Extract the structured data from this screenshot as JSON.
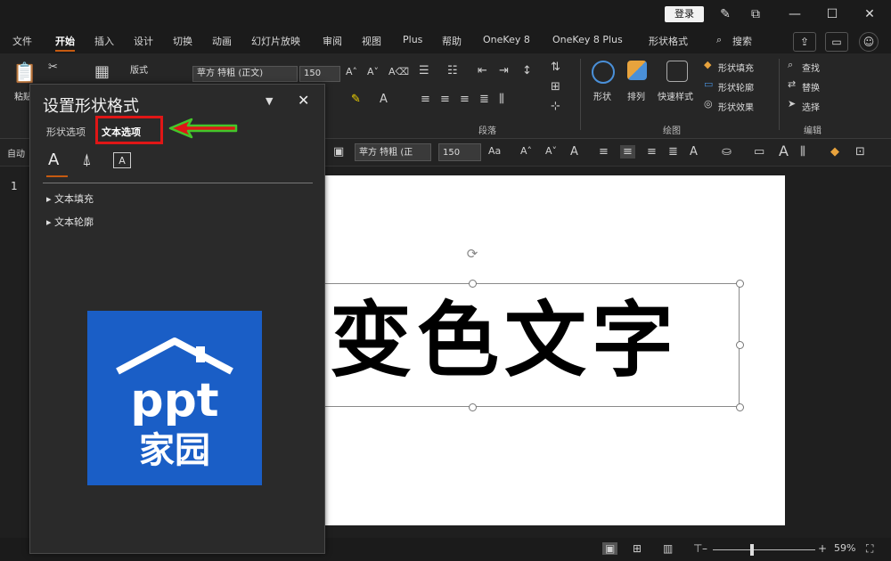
{
  "titlebar": {
    "login_label": "登录",
    "icons": [
      "pen-icon",
      "share-icon",
      "minimize-icon",
      "maximize-icon",
      "close-icon"
    ]
  },
  "ribbon_tabs": [
    {
      "label": "文件",
      "active": false
    },
    {
      "label": "开始",
      "active": true
    },
    {
      "label": "插入",
      "active": false
    },
    {
      "label": "设计",
      "active": false
    },
    {
      "label": "切换",
      "active": false
    },
    {
      "label": "动画",
      "active": false
    },
    {
      "label": "幻灯片放映",
      "active": false
    },
    {
      "label": "审阅",
      "active": false
    },
    {
      "label": "视图",
      "active": false
    },
    {
      "label": "Plus",
      "active": false
    },
    {
      "label": "帮助",
      "active": false
    },
    {
      "label": "OneKey 8",
      "active": false
    },
    {
      "label": "OneKey 8 Plus",
      "active": false
    },
    {
      "label": "形状格式",
      "active": false
    }
  ],
  "search_label": "搜索",
  "ribbon": {
    "paste_label": "粘贴",
    "layout_label": "版式",
    "font_name": "苹方 特粗 (正文)",
    "font_size": "150",
    "paragraph_group": "段落",
    "drawing_group": "绘图",
    "editing_group": "编辑",
    "shape_label": "形状",
    "arrange_label": "排列",
    "quick_style_label": "快速样式",
    "shape_fill_label": "形状填充",
    "shape_outline_label": "形状轮廓",
    "shape_effect_label": "形状效果",
    "find_label": "查找",
    "replace_label": "替换",
    "select_label": "选择"
  },
  "format_bar": {
    "auto_label": "自动",
    "font_name": "苹方 特粗 (正",
    "font_size": "150"
  },
  "thumbnail_number": "1",
  "slide": {
    "text": "变色文字"
  },
  "pane": {
    "title": "设置形状格式",
    "tab_shape": "形状选项",
    "tab_text": "文本选项",
    "icon_A_label": "A",
    "icon_C_label": "A",
    "sections": [
      "文本填充",
      "文本轮廓"
    ],
    "logo_line1": "ppt",
    "logo_line2": "家园"
  },
  "statusbar": {
    "zoom": "59%"
  },
  "colors": {
    "annotation_box": "#e01616",
    "arrow_fill": "#e01616",
    "arrow_outline": "#43c62a",
    "logo_background": "#1a5ec6",
    "accent": "#c55a11"
  }
}
